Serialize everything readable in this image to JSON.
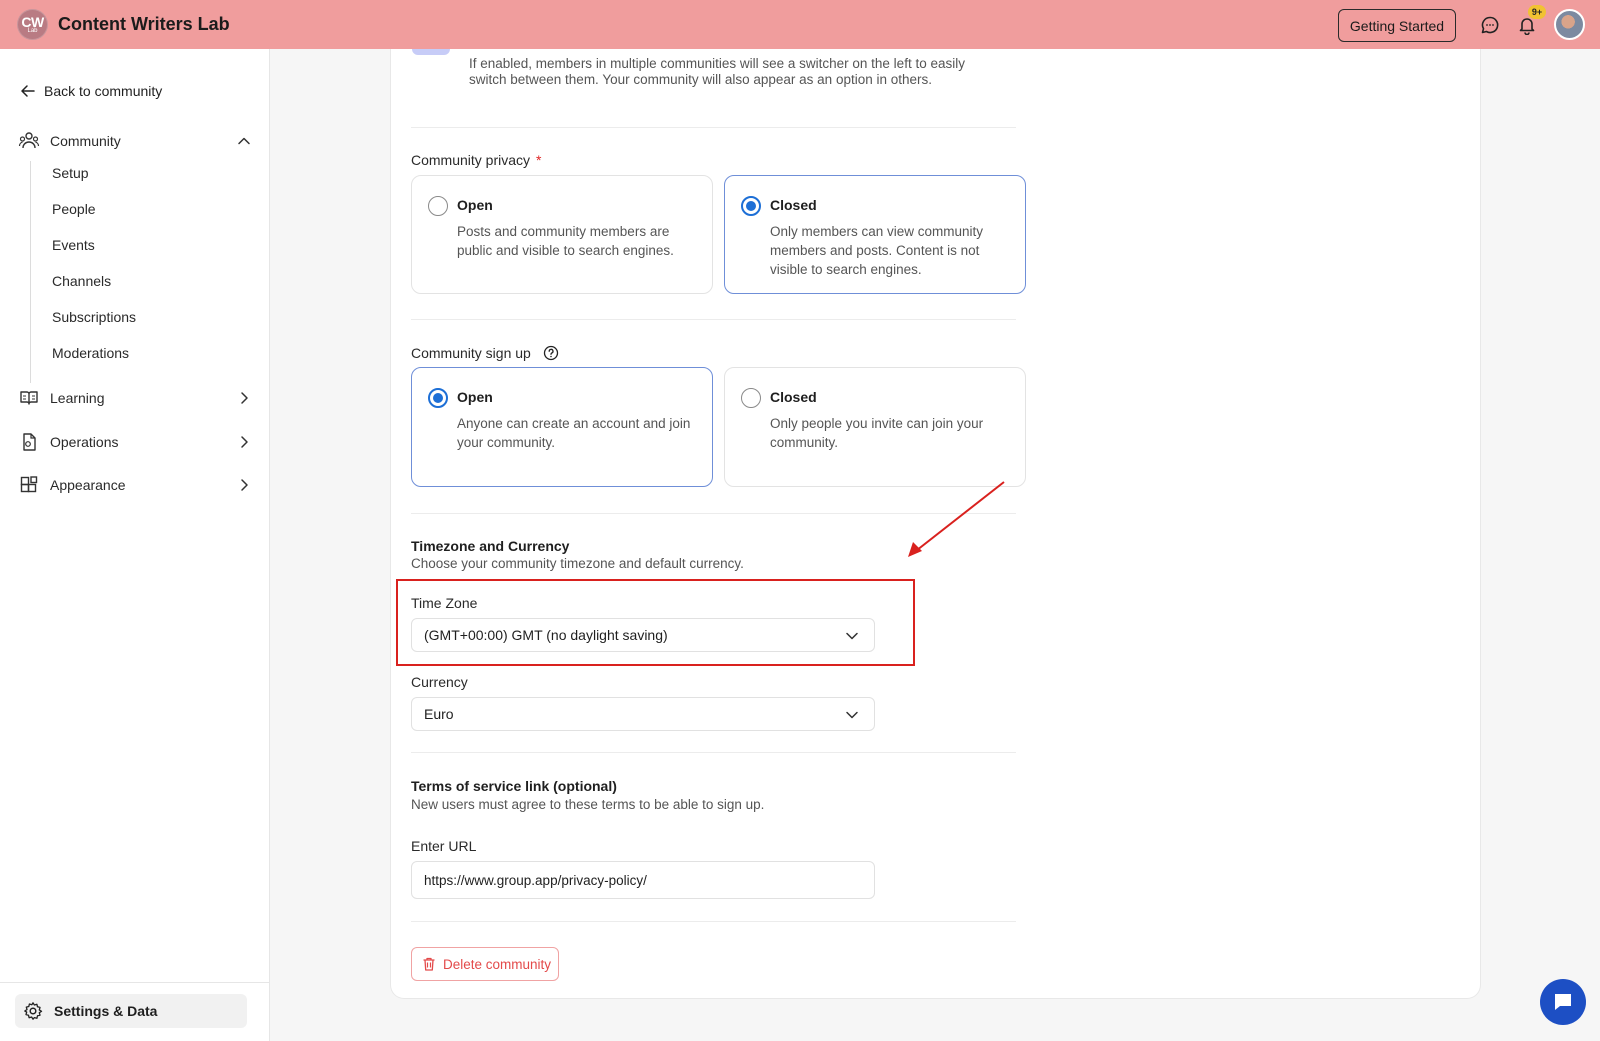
{
  "header": {
    "logo_text": "CW",
    "logo_sub": "Lab",
    "app_title": "Content Writers Lab",
    "getting_started": "Getting Started",
    "notification_badge": "9+"
  },
  "sidebar": {
    "back_link": "Back to community",
    "community": {
      "label": "Community",
      "sub_items": [
        "Setup",
        "People",
        "Events",
        "Channels",
        "Subscriptions",
        "Moderations"
      ]
    },
    "learning": "Learning",
    "operations": "Operations",
    "appearance": "Appearance",
    "settings": "Settings & Data"
  },
  "main": {
    "switcher_description": "If enabled, members in multiple communities will see a switcher on the left to easily switch between them. Your community will also appear as an option in others.",
    "privacy": {
      "label": "Community privacy",
      "required_mark": "*",
      "open": {
        "title": "Open",
        "description": "Posts and community members are public and visible to search engines."
      },
      "closed": {
        "title": "Closed",
        "description": "Only members can view community members and posts. Content is not visible to search engines."
      },
      "selected": "closed"
    },
    "signup": {
      "label": "Community sign up",
      "open": {
        "title": "Open",
        "description": "Anyone can create an account and join your community."
      },
      "closed": {
        "title": "Closed",
        "description": "Only people you invite can join your community."
      },
      "selected": "open"
    },
    "timezone_currency": {
      "title": "Timezone and Currency",
      "subtitle": "Choose your community timezone and default currency.",
      "time_zone_label": "Time Zone",
      "time_zone_value": "(GMT+00:00) GMT (no daylight saving)",
      "currency_label": "Currency",
      "currency_value": "Euro"
    },
    "terms": {
      "title": "Terms of service link (optional)",
      "subtitle": "New users must agree to these terms to be able to sign up.",
      "url_label": "Enter URL",
      "url_value": "https://www.group.app/privacy-policy/"
    },
    "delete_button": "Delete community"
  },
  "colors": {
    "header_bg": "#f09d9d",
    "accent_blue": "#1d6fd6",
    "danger_red": "#e34a4a",
    "annotation_red": "#d9211e",
    "chat_fab": "#1d4fc4"
  }
}
